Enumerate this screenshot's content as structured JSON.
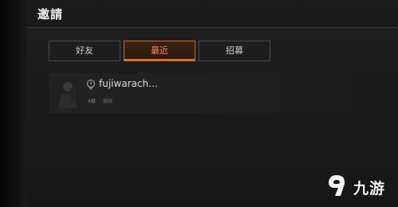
{
  "header": {
    "title": "邀請",
    "hint": ""
  },
  "tabs": [
    {
      "label": "好友",
      "active": false
    },
    {
      "label": "最近",
      "active": true
    },
    {
      "label": "招募",
      "active": false
    }
  ],
  "player": {
    "name": "fujiwarach…",
    "level": "4級",
    "status": "離線"
  },
  "colors": {
    "accent": "#e2712f",
    "accent_text": "#ff8a4a",
    "panel": "#1c1c1c"
  },
  "watermark": {
    "text": "九游",
    "logo_icon": "jiuyou-logo-icon"
  }
}
